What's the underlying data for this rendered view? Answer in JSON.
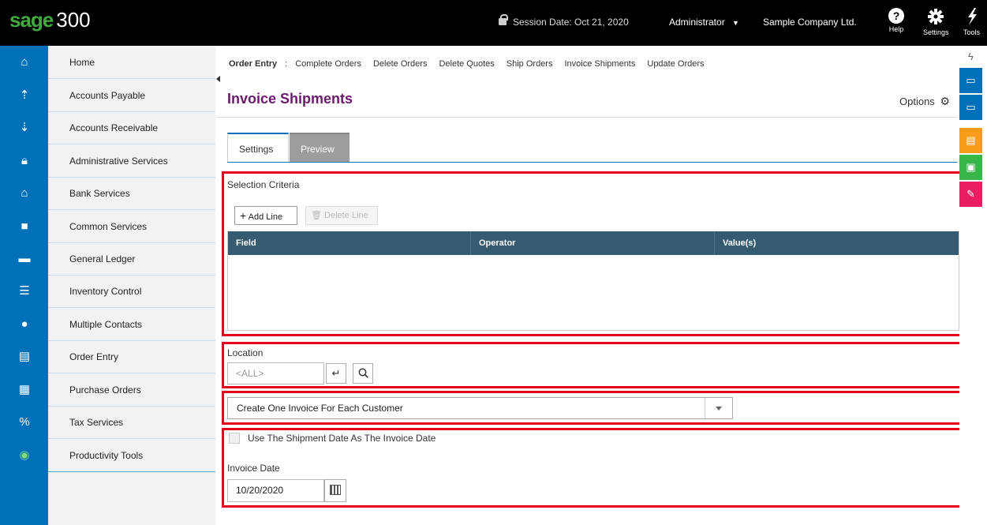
{
  "header": {
    "brand": "sage",
    "version": "300",
    "session_date": "Session Date:  Oct 21, 2020",
    "user": "Administrator",
    "company": "Sample Company Ltd.",
    "help_label": "Help",
    "settings_label": "Settings",
    "tools_label": "Tools"
  },
  "sidebar": {
    "items": [
      {
        "label": "Home",
        "icon": "home-icon"
      },
      {
        "label": "Accounts Payable",
        "icon": "accounts-payable-icon"
      },
      {
        "label": "Accounts Receivable",
        "icon": "accounts-receivable-icon"
      },
      {
        "label": "Administrative Services",
        "icon": "lock-icon"
      },
      {
        "label": "Bank Services",
        "icon": "bank-icon"
      },
      {
        "label": "Common Services",
        "icon": "briefcase-icon"
      },
      {
        "label": "General Ledger",
        "icon": "folder-icon"
      },
      {
        "label": "Inventory Control",
        "icon": "inventory-icon"
      },
      {
        "label": "Multiple Contacts",
        "icon": "contacts-icon"
      },
      {
        "label": "Order Entry",
        "icon": "order-entry-icon"
      },
      {
        "label": "Purchase Orders",
        "icon": "purchase-orders-icon"
      },
      {
        "label": "Tax Services",
        "icon": "tax-icon"
      },
      {
        "label": "Productivity Tools",
        "icon": "productivity-icon"
      }
    ]
  },
  "breadcrumb": {
    "root": "Order Entry",
    "separator": ":",
    "links": [
      "Complete Orders",
      "Delete Orders",
      "Delete Quotes",
      "Ship Orders",
      "Invoice Shipments",
      "Update Orders"
    ]
  },
  "page": {
    "title": "Invoice Shipments",
    "options_label": "Options"
  },
  "tabs": {
    "settings": "Settings",
    "preview": "Preview"
  },
  "selection": {
    "label": "Selection Criteria",
    "add_line": "Add Line",
    "delete_line": "Delete Line",
    "columns": [
      "Field",
      "Operator",
      "Value(s)"
    ]
  },
  "location": {
    "label": "Location",
    "placeholder": "<ALL>"
  },
  "invoice_mode": {
    "selected": "Create One Invoice For Each Customer"
  },
  "invoice_date": {
    "checkbox_label": "Use The Shipment Date As The Invoice Date",
    "label": "Invoice Date",
    "value": "10/20/2020"
  },
  "colors": {
    "accent": "#0070b8",
    "title": "#6b1a6b",
    "grid_header": "#345b6f",
    "highlight": "#e5001e"
  }
}
